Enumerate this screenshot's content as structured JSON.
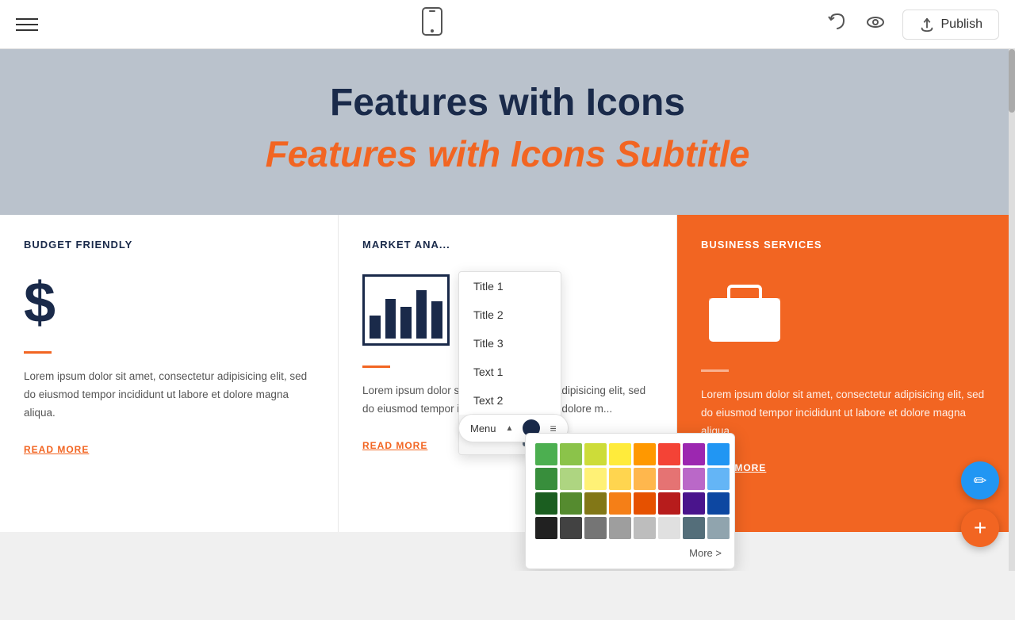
{
  "nav": {
    "publish_label": "Publish"
  },
  "hero": {
    "title": "Features with Icons",
    "subtitle": "Features with Icons Subtitle"
  },
  "cards": [
    {
      "id": "budget-friendly",
      "title": "BUDGET FRIENDLY",
      "icon_type": "dollar",
      "text": "Lorem ipsum dolor sit amet, consectetur adipisicing elit, sed do eiusmod tempor incididunt ut labore et dolore magna aliqua.",
      "read_more": "READ MORE",
      "theme": "white"
    },
    {
      "id": "market-analysis",
      "title": "MARKET ANA...",
      "icon_type": "barchart",
      "text": "Lorem ipsum dolor sit amet, consectetur adipisicing elit, sed do eiusmod tempor incididunt ut labore et dolore m...",
      "read_more": "READ MORE",
      "theme": "white"
    },
    {
      "id": "business-services",
      "title": "BUSINESS SERVICES",
      "icon_type": "briefcase",
      "text": "Lorem ipsum dolor sit amet, consectetur adipisicing elit, sed do eiusmod tempor incididunt ut labore et dolore magna aliqua.",
      "read_more": "READ MORE",
      "theme": "orange"
    }
  ],
  "dropdown": {
    "items": [
      {
        "label": "Title 1"
      },
      {
        "label": "Title 2"
      },
      {
        "label": "Title 3"
      },
      {
        "label": "Text 1"
      },
      {
        "label": "Text 2"
      },
      {
        "label": "Menu",
        "selected": true
      }
    ]
  },
  "menu_bar": {
    "label": "Menu"
  },
  "color_picker": {
    "colors": [
      "#4caf50",
      "#8bc34a",
      "#cddc39",
      "#ffeb3b",
      "#ff9800",
      "#f44336",
      "#9c27b0",
      "#2196f3",
      "#388e3c",
      "#aed581",
      "#fff176",
      "#ffd54f",
      "#ffb74d",
      "#e57373",
      "#ba68c8",
      "#64b5f6",
      "#1b5e20",
      "#558b2f",
      "#827717",
      "#f57f17",
      "#e65100",
      "#b71c1c",
      "#4a148c",
      "#0d47a1",
      "#212121",
      "#424242",
      "#757575",
      "#9e9e9e",
      "#bdbdbd",
      "#e0e0e0",
      "#546e7a",
      "#90a4ae"
    ],
    "more_label": "More >"
  }
}
